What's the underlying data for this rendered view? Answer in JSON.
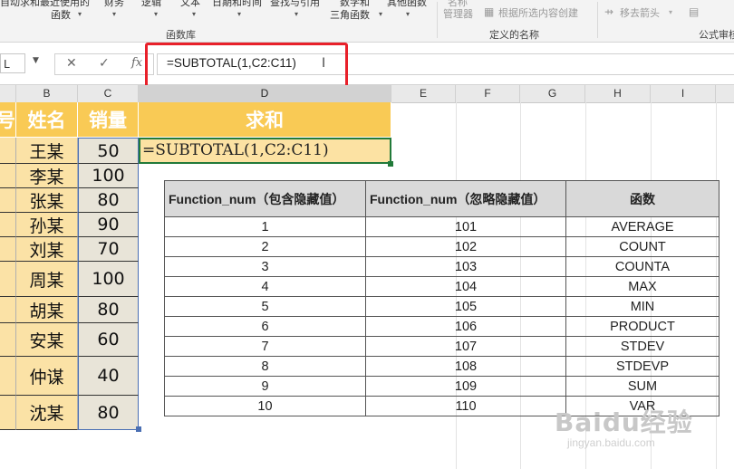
{
  "ribbon": {
    "top_items": [
      "自动求和",
      "最近使用的",
      "财务",
      "逻辑",
      "文本",
      "日期和时间",
      "查找与引用",
      "数学和",
      "其他函数"
    ],
    "second_items": [
      "函数",
      "三角函数"
    ],
    "function_library_label": "函数库",
    "name_manager_top": "名称",
    "name_manager_label": "管理器",
    "create_from_selection_label": "根据所选内容创建",
    "defined_names_label": "定义的名称",
    "remove_arrows_label": "移去箭头",
    "formula_auditing_label": "公式审核"
  },
  "formula_bar": {
    "name_box": "L",
    "formula": "=SUBTOTAL(1,C2:C11)",
    "cancel_icon": "✕",
    "enter_icon": "✓",
    "fx_label": "fx"
  },
  "columns": [
    "B",
    "C",
    "D",
    "E",
    "F",
    "G",
    "H",
    "I"
  ],
  "sheet": {
    "a_header": "号",
    "b_header": "姓名",
    "c_header": "销量",
    "d_header": "求和",
    "d2_formula": "=SUBTOTAL(1,C2:C11)",
    "rows": [
      {
        "name": "王某",
        "sales": "50"
      },
      {
        "name": "李某",
        "sales": "100"
      },
      {
        "name": "张某",
        "sales": "80"
      },
      {
        "name": "孙某",
        "sales": "90"
      },
      {
        "name": "刘某",
        "sales": "70"
      },
      {
        "name": "周某",
        "sales": "100"
      },
      {
        "name": "胡某",
        "sales": "80"
      },
      {
        "name": "安某",
        "sales": "60"
      },
      {
        "name": "仲谋",
        "sales": "40"
      },
      {
        "name": "沈某",
        "sales": "80"
      }
    ]
  },
  "reference_table": {
    "headers": [
      "Function_num（包含隐藏值）",
      "Function_num（忽略隐藏值）",
      "函数"
    ],
    "rows": [
      [
        "1",
        "101",
        "AVERAGE"
      ],
      [
        "2",
        "102",
        "COUNT"
      ],
      [
        "3",
        "103",
        "COUNTA"
      ],
      [
        "4",
        "104",
        "MAX"
      ],
      [
        "5",
        "105",
        "MIN"
      ],
      [
        "6",
        "106",
        "PRODUCT"
      ],
      [
        "7",
        "107",
        "STDEV"
      ],
      [
        "8",
        "108",
        "STDEVP"
      ],
      [
        "9",
        "109",
        "SUM"
      ],
      [
        "10",
        "110",
        "VAR"
      ]
    ]
  },
  "watermark": {
    "text": "Baidu经验",
    "url": "jingyan.baidu.com"
  },
  "colors": {
    "header_fill": "#f9ca55",
    "row_fill": "#fbe2a6",
    "highlight": "#e8202a",
    "active_cell_border": "#227a3a"
  }
}
